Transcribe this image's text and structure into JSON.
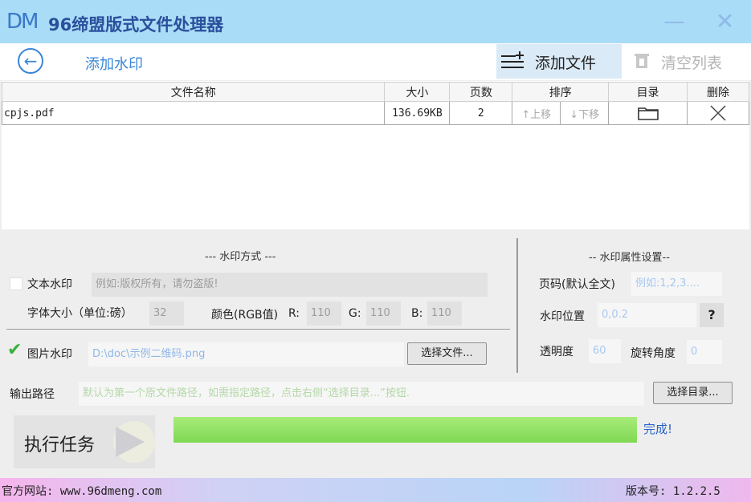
{
  "app": {
    "logo": "DM",
    "title": "96缔盟版式文件处理器",
    "minimize": "—",
    "close": "✕"
  },
  "toolbar": {
    "back_icon": "arrow-left-icon",
    "page_title": "添加水印",
    "add_file": "添加文件",
    "clear_list": "清空列表"
  },
  "table": {
    "headers": [
      "文件名称",
      "大小",
      "页数",
      "排序",
      "目录",
      "删除"
    ],
    "rows": [
      {
        "name": "cpjs.pdf",
        "size": "136.69KB",
        "pages": "2",
        "move_up": "↑上移",
        "move_down": "↓下移"
      }
    ]
  },
  "wm_mode": {
    "section_title": "--- 水印方式 ---",
    "text_wm_label": "文本水印",
    "text_wm_placeholder": "例如:版权所有，请勿盗版!",
    "font_size_label": "字体大小（单位:磅）",
    "font_size_value": "32",
    "color_label": "颜色(RGB值)",
    "r_label": "R:",
    "r_value": "110",
    "g_label": "G:",
    "g_value": "110",
    "b_label": "B:",
    "b_value": "110",
    "img_wm_label": "图片水印",
    "img_path": "D:\\doc\\示例二维码.png",
    "choose_file": "选择文件..."
  },
  "wm_props": {
    "section_title": "-- 水印属性设置--",
    "page_label": "页码(默认全文)",
    "page_placeholder": "例如:1,2,3....",
    "position_label": "水印位置",
    "position_value": "0,0.2",
    "help": "?",
    "opacity_label": "透明度",
    "opacity_value": "60",
    "rotate_label": "旋转角度",
    "rotate_value": "0"
  },
  "output": {
    "label": "输出路径",
    "placeholder": "默认为第一个原文件路径，如需指定路径，点击右侧“选择目录...”按钮.",
    "choose_dir": "选择目录..."
  },
  "run": {
    "label": "执行任务",
    "progress": 1.0,
    "status": "完成!"
  },
  "footer": {
    "site": "官方网站:  www.96dmeng.com",
    "version": "版本号: 1.2.2.5"
  }
}
